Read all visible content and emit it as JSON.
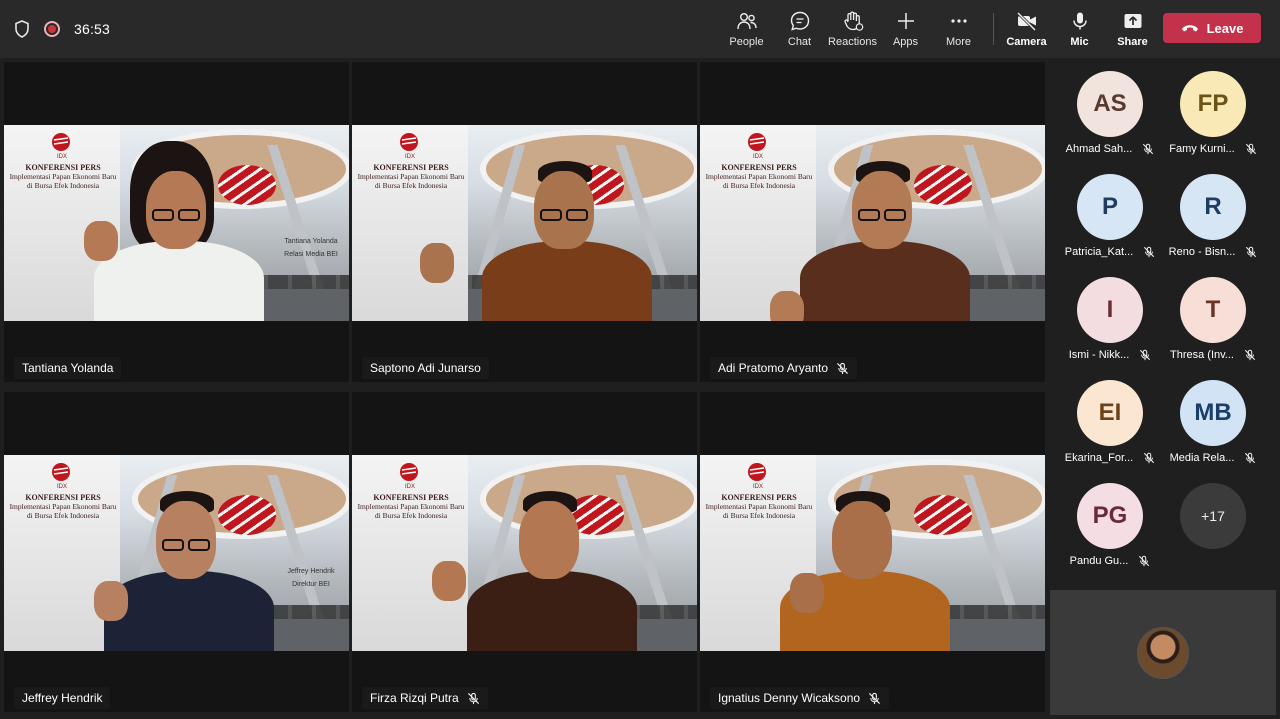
{
  "topbar": {
    "timer": "36:53",
    "actions": [
      {
        "label": "People",
        "icon": "people-icon"
      },
      {
        "label": "Chat",
        "icon": "chat-icon"
      },
      {
        "label": "Reactions",
        "icon": "reactions-icon"
      },
      {
        "label": "Apps",
        "icon": "apps-icon"
      },
      {
        "label": "More",
        "icon": "more-icon"
      }
    ],
    "devices": [
      {
        "label": "Camera",
        "icon": "camera-icon"
      },
      {
        "label": "Mic",
        "icon": "mic-icon"
      },
      {
        "label": "Share",
        "icon": "share-icon"
      }
    ],
    "leave_label": "Leave"
  },
  "backdrop": {
    "logo_text": "IDX",
    "line1": "KONFERENSI PERS",
    "line2": "Implementasi Papan Ekonomi Baru",
    "line3": "di Bursa Efek Indonesia"
  },
  "tiles": [
    {
      "name": "Tantiana Yolanda",
      "muted": false,
      "caption1": "Tantiana Yolanda",
      "caption2": "Relasi Media BEI"
    },
    {
      "name": "Saptono Adi Junarso",
      "muted": false,
      "caption1": "",
      "caption2": ""
    },
    {
      "name": "Adi Pratomo Aryanto",
      "muted": true,
      "caption1": "",
      "caption2": ""
    },
    {
      "name": "Jeffrey Hendrik",
      "muted": false,
      "caption1": "Jeffrey Hendrik",
      "caption2": "Direktur BEI"
    },
    {
      "name": "Firza Rizqi Putra",
      "muted": true,
      "caption1": "",
      "caption2": ""
    },
    {
      "name": "Ignatius Denny Wicaksono",
      "muted": true,
      "caption1": "",
      "caption2": ""
    }
  ],
  "participants": [
    {
      "initials": "AS",
      "name": "Ahmad Sah...",
      "bg": "#f1e4df",
      "fg": "#5b3a2e"
    },
    {
      "initials": "FP",
      "name": "Famy Kurni...",
      "bg": "#f8e9b6",
      "fg": "#6b5217"
    },
    {
      "initials": "P",
      "name": "Patricia_Kat...",
      "bg": "#d6e6f5",
      "fg": "#1f3c63"
    },
    {
      "initials": "R",
      "name": "Reno - Bisn...",
      "bg": "#d6e6f5",
      "fg": "#1f3c63"
    },
    {
      "initials": "I",
      "name": "Ismi - Nikk...",
      "bg": "#f3dde0",
      "fg": "#6b2c33"
    },
    {
      "initials": "T",
      "name": "Thresa (Inv...",
      "bg": "#f7ded7",
      "fg": "#6b3424"
    },
    {
      "initials": "EI",
      "name": "Ekarina_For...",
      "bg": "#fbe6d2",
      "fg": "#6e4219"
    },
    {
      "initials": "MB",
      "name": "Media Rela...",
      "bg": "#d3e3f6",
      "fg": "#1b3d6a"
    },
    {
      "initials": "PG",
      "name": "Pandu Gu...",
      "bg": "#f5dde4",
      "fg": "#6b2a3a"
    }
  ],
  "overflow_label": "+17"
}
